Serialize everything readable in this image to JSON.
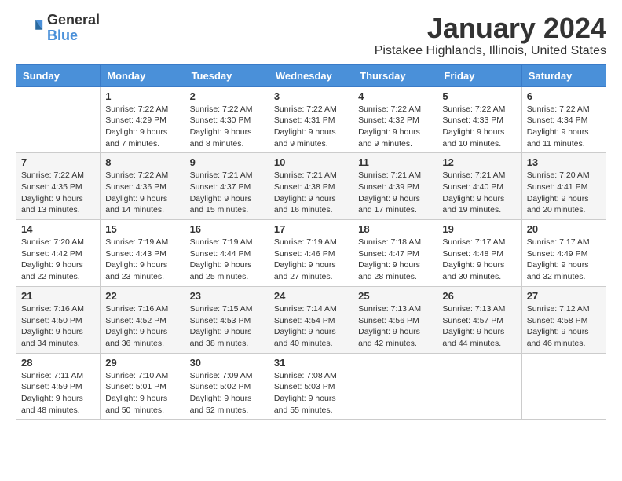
{
  "header": {
    "logo_general": "General",
    "logo_blue": "Blue",
    "month_title": "January 2024",
    "location": "Pistakee Highlands, Illinois, United States"
  },
  "weekdays": [
    "Sunday",
    "Monday",
    "Tuesday",
    "Wednesday",
    "Thursday",
    "Friday",
    "Saturday"
  ],
  "weeks": [
    [
      {
        "day": "",
        "sunrise": "",
        "sunset": "",
        "daylight": ""
      },
      {
        "day": "1",
        "sunrise": "Sunrise: 7:22 AM",
        "sunset": "Sunset: 4:29 PM",
        "daylight": "Daylight: 9 hours and 7 minutes."
      },
      {
        "day": "2",
        "sunrise": "Sunrise: 7:22 AM",
        "sunset": "Sunset: 4:30 PM",
        "daylight": "Daylight: 9 hours and 8 minutes."
      },
      {
        "day": "3",
        "sunrise": "Sunrise: 7:22 AM",
        "sunset": "Sunset: 4:31 PM",
        "daylight": "Daylight: 9 hours and 9 minutes."
      },
      {
        "day": "4",
        "sunrise": "Sunrise: 7:22 AM",
        "sunset": "Sunset: 4:32 PM",
        "daylight": "Daylight: 9 hours and 9 minutes."
      },
      {
        "day": "5",
        "sunrise": "Sunrise: 7:22 AM",
        "sunset": "Sunset: 4:33 PM",
        "daylight": "Daylight: 9 hours and 10 minutes."
      },
      {
        "day": "6",
        "sunrise": "Sunrise: 7:22 AM",
        "sunset": "Sunset: 4:34 PM",
        "daylight": "Daylight: 9 hours and 11 minutes."
      }
    ],
    [
      {
        "day": "7",
        "sunrise": "Sunrise: 7:22 AM",
        "sunset": "Sunset: 4:35 PM",
        "daylight": "Daylight: 9 hours and 13 minutes."
      },
      {
        "day": "8",
        "sunrise": "Sunrise: 7:22 AM",
        "sunset": "Sunset: 4:36 PM",
        "daylight": "Daylight: 9 hours and 14 minutes."
      },
      {
        "day": "9",
        "sunrise": "Sunrise: 7:21 AM",
        "sunset": "Sunset: 4:37 PM",
        "daylight": "Daylight: 9 hours and 15 minutes."
      },
      {
        "day": "10",
        "sunrise": "Sunrise: 7:21 AM",
        "sunset": "Sunset: 4:38 PM",
        "daylight": "Daylight: 9 hours and 16 minutes."
      },
      {
        "day": "11",
        "sunrise": "Sunrise: 7:21 AM",
        "sunset": "Sunset: 4:39 PM",
        "daylight": "Daylight: 9 hours and 17 minutes."
      },
      {
        "day": "12",
        "sunrise": "Sunrise: 7:21 AM",
        "sunset": "Sunset: 4:40 PM",
        "daylight": "Daylight: 9 hours and 19 minutes."
      },
      {
        "day": "13",
        "sunrise": "Sunrise: 7:20 AM",
        "sunset": "Sunset: 4:41 PM",
        "daylight": "Daylight: 9 hours and 20 minutes."
      }
    ],
    [
      {
        "day": "14",
        "sunrise": "Sunrise: 7:20 AM",
        "sunset": "Sunset: 4:42 PM",
        "daylight": "Daylight: 9 hours and 22 minutes."
      },
      {
        "day": "15",
        "sunrise": "Sunrise: 7:19 AM",
        "sunset": "Sunset: 4:43 PM",
        "daylight": "Daylight: 9 hours and 23 minutes."
      },
      {
        "day": "16",
        "sunrise": "Sunrise: 7:19 AM",
        "sunset": "Sunset: 4:44 PM",
        "daylight": "Daylight: 9 hours and 25 minutes."
      },
      {
        "day": "17",
        "sunrise": "Sunrise: 7:19 AM",
        "sunset": "Sunset: 4:46 PM",
        "daylight": "Daylight: 9 hours and 27 minutes."
      },
      {
        "day": "18",
        "sunrise": "Sunrise: 7:18 AM",
        "sunset": "Sunset: 4:47 PM",
        "daylight": "Daylight: 9 hours and 28 minutes."
      },
      {
        "day": "19",
        "sunrise": "Sunrise: 7:17 AM",
        "sunset": "Sunset: 4:48 PM",
        "daylight": "Daylight: 9 hours and 30 minutes."
      },
      {
        "day": "20",
        "sunrise": "Sunrise: 7:17 AM",
        "sunset": "Sunset: 4:49 PM",
        "daylight": "Daylight: 9 hours and 32 minutes."
      }
    ],
    [
      {
        "day": "21",
        "sunrise": "Sunrise: 7:16 AM",
        "sunset": "Sunset: 4:50 PM",
        "daylight": "Daylight: 9 hours and 34 minutes."
      },
      {
        "day": "22",
        "sunrise": "Sunrise: 7:16 AM",
        "sunset": "Sunset: 4:52 PM",
        "daylight": "Daylight: 9 hours and 36 minutes."
      },
      {
        "day": "23",
        "sunrise": "Sunrise: 7:15 AM",
        "sunset": "Sunset: 4:53 PM",
        "daylight": "Daylight: 9 hours and 38 minutes."
      },
      {
        "day": "24",
        "sunrise": "Sunrise: 7:14 AM",
        "sunset": "Sunset: 4:54 PM",
        "daylight": "Daylight: 9 hours and 40 minutes."
      },
      {
        "day": "25",
        "sunrise": "Sunrise: 7:13 AM",
        "sunset": "Sunset: 4:56 PM",
        "daylight": "Daylight: 9 hours and 42 minutes."
      },
      {
        "day": "26",
        "sunrise": "Sunrise: 7:13 AM",
        "sunset": "Sunset: 4:57 PM",
        "daylight": "Daylight: 9 hours and 44 minutes."
      },
      {
        "day": "27",
        "sunrise": "Sunrise: 7:12 AM",
        "sunset": "Sunset: 4:58 PM",
        "daylight": "Daylight: 9 hours and 46 minutes."
      }
    ],
    [
      {
        "day": "28",
        "sunrise": "Sunrise: 7:11 AM",
        "sunset": "Sunset: 4:59 PM",
        "daylight": "Daylight: 9 hours and 48 minutes."
      },
      {
        "day": "29",
        "sunrise": "Sunrise: 7:10 AM",
        "sunset": "Sunset: 5:01 PM",
        "daylight": "Daylight: 9 hours and 50 minutes."
      },
      {
        "day": "30",
        "sunrise": "Sunrise: 7:09 AM",
        "sunset": "Sunset: 5:02 PM",
        "daylight": "Daylight: 9 hours and 52 minutes."
      },
      {
        "day": "31",
        "sunrise": "Sunrise: 7:08 AM",
        "sunset": "Sunset: 5:03 PM",
        "daylight": "Daylight: 9 hours and 55 minutes."
      },
      {
        "day": "",
        "sunrise": "",
        "sunset": "",
        "daylight": ""
      },
      {
        "day": "",
        "sunrise": "",
        "sunset": "",
        "daylight": ""
      },
      {
        "day": "",
        "sunrise": "",
        "sunset": "",
        "daylight": ""
      }
    ]
  ]
}
